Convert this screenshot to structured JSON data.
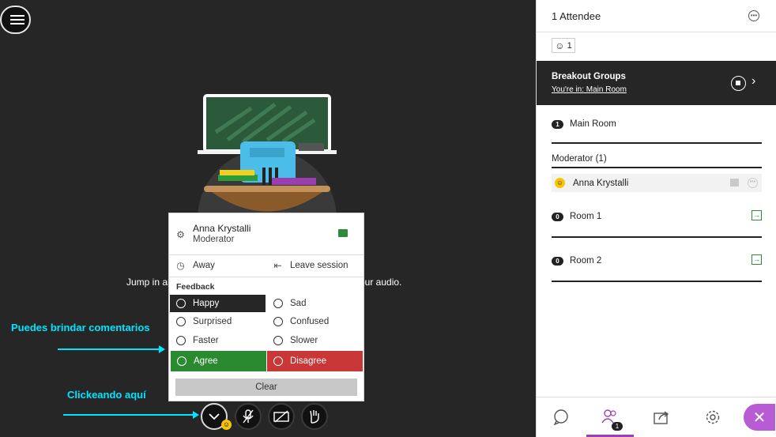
{
  "stage": {
    "text_left": "Jump in ar",
    "text_right": "our audio."
  },
  "annotations": {
    "feedback_hint": "Puedes brindar comentarios",
    "click_hint": "Clickeando aquí"
  },
  "popup": {
    "user_name": "Anna Krystalli",
    "user_role": "Moderator",
    "away": "Away",
    "leave": "Leave session",
    "feedback_heading": "Feedback",
    "options": [
      "Happy",
      "Sad",
      "Surprised",
      "Confused",
      "Faster",
      "Slower",
      "Agree",
      "Disagree"
    ],
    "clear": "Clear"
  },
  "panel": {
    "title": "1 Attendee",
    "status_count": "1",
    "breakout": {
      "title": "Breakout Groups",
      "link": "You're in: Main Room"
    },
    "main_room": {
      "badge": "1",
      "label": "Main Room"
    },
    "moderator_heading": "Moderator (1)",
    "attendee_name": "Anna Krystalli",
    "rooms": [
      {
        "badge": "0",
        "label": "Room 1"
      },
      {
        "badge": "0",
        "label": "Room 2"
      }
    ],
    "attendees_tab_badge": "1"
  },
  "colors": {
    "agree": "#2a8a2f",
    "disagree": "#c93737",
    "accent": "#b85cd6",
    "annotation": "#00e5ff"
  }
}
